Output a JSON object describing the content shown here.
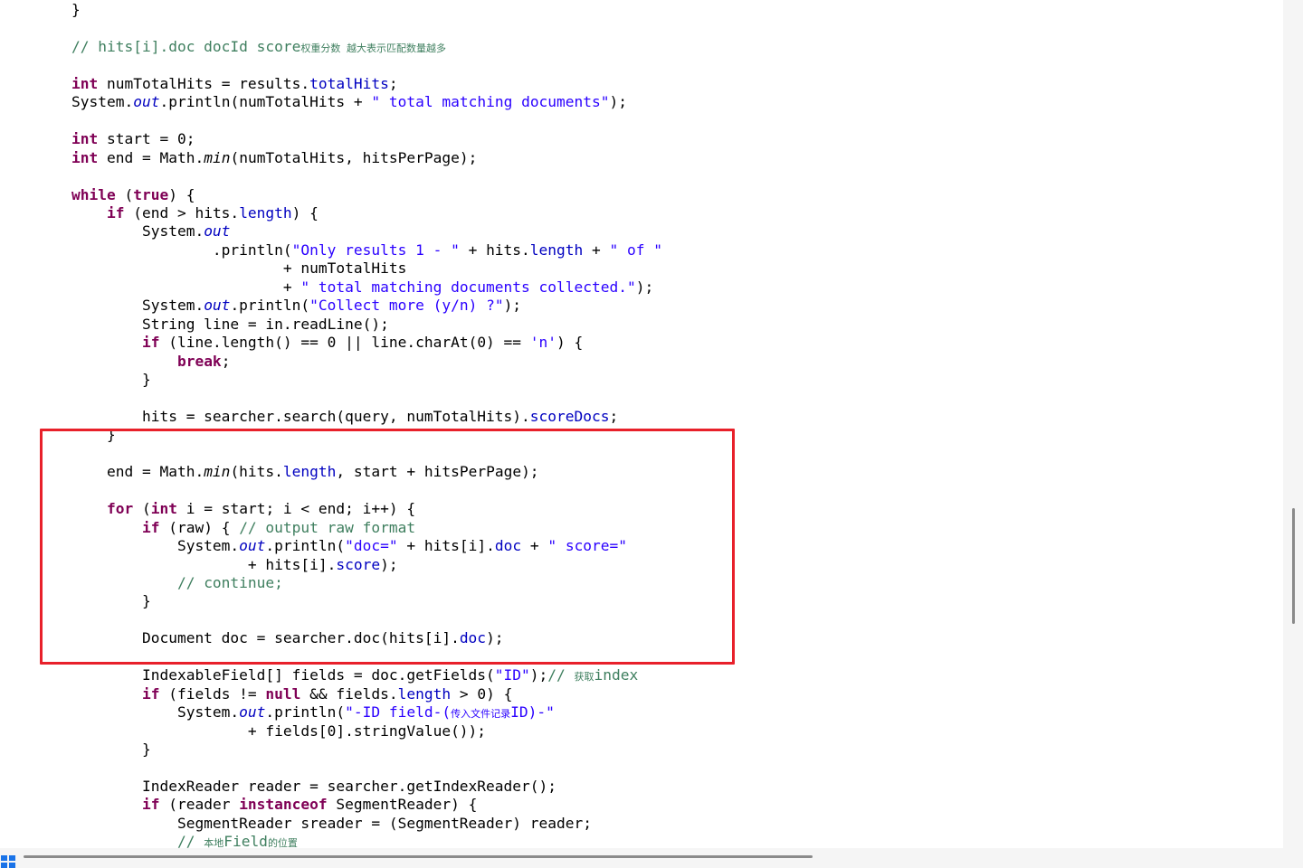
{
  "colors": {
    "keyword": "#7f0055",
    "string": "#2a00ff",
    "field": "#0000c0",
    "comment": "#3f7f5f",
    "highlight_border": "#e8202a"
  },
  "code_lines": [
    [
      {
        "t": "}"
      }
    ],
    [],
    [
      {
        "t": "// hits[i].doc docId score",
        "c": "cm"
      },
      {
        "t": "权重分数 越大表示匹配数量越多",
        "c": "cm cm-cn"
      }
    ],
    [],
    [
      {
        "t": "int",
        "c": "kw"
      },
      {
        "t": " numTotalHits = results."
      },
      {
        "t": "totalHits",
        "c": "fld"
      },
      {
        "t": ";"
      }
    ],
    [
      {
        "t": "System."
      },
      {
        "t": "out",
        "c": "sfld"
      },
      {
        "t": ".println(numTotalHits + "
      },
      {
        "t": "\" total matching documents\"",
        "c": "str"
      },
      {
        "t": ");"
      }
    ],
    [],
    [
      {
        "t": "int",
        "c": "kw"
      },
      {
        "t": " start = 0;"
      }
    ],
    [
      {
        "t": "int",
        "c": "kw"
      },
      {
        "t": " end = Math."
      },
      {
        "t": "min",
        "c": "sm"
      },
      {
        "t": "(numTotalHits, hitsPerPage);"
      }
    ],
    [],
    [
      {
        "t": "while",
        "c": "kw"
      },
      {
        "t": " ("
      },
      {
        "t": "true",
        "c": "kw"
      },
      {
        "t": ") {"
      }
    ],
    [
      {
        "t": "    "
      },
      {
        "t": "if",
        "c": "kw"
      },
      {
        "t": " (end > hits."
      },
      {
        "t": "length",
        "c": "fld"
      },
      {
        "t": ") {"
      }
    ],
    [
      {
        "t": "        System."
      },
      {
        "t": "out",
        "c": "sfld"
      }
    ],
    [
      {
        "t": "                .println("
      },
      {
        "t": "\"Only results 1 - \"",
        "c": "str"
      },
      {
        "t": " + hits."
      },
      {
        "t": "length",
        "c": "fld"
      },
      {
        "t": " + "
      },
      {
        "t": "\" of \"",
        "c": "str"
      }
    ],
    [
      {
        "t": "                        + numTotalHits"
      }
    ],
    [
      {
        "t": "                        + "
      },
      {
        "t": "\" total matching documents collected.\"",
        "c": "str"
      },
      {
        "t": ");"
      }
    ],
    [
      {
        "t": "        System."
      },
      {
        "t": "out",
        "c": "sfld"
      },
      {
        "t": ".println("
      },
      {
        "t": "\"Collect more (y/n) ?\"",
        "c": "str"
      },
      {
        "t": ");"
      }
    ],
    [
      {
        "t": "        String line = in.readLine();"
      }
    ],
    [
      {
        "t": "        "
      },
      {
        "t": "if",
        "c": "kw"
      },
      {
        "t": " (line.length() == 0 || line.charAt(0) == "
      },
      {
        "t": "'n'",
        "c": "str"
      },
      {
        "t": ") {"
      }
    ],
    [
      {
        "t": "            "
      },
      {
        "t": "break",
        "c": "kw"
      },
      {
        "t": ";"
      }
    ],
    [
      {
        "t": "        }"
      }
    ],
    [],
    [
      {
        "t": "        hits = searcher.search(query, numTotalHits)."
      },
      {
        "t": "scoreDocs",
        "c": "fld"
      },
      {
        "t": ";"
      }
    ],
    [
      {
        "t": "    }"
      }
    ],
    [],
    [
      {
        "t": "    end = Math."
      },
      {
        "t": "min",
        "c": "sm"
      },
      {
        "t": "(hits."
      },
      {
        "t": "length",
        "c": "fld"
      },
      {
        "t": ", start + hitsPerPage);"
      }
    ],
    [],
    [
      {
        "t": "    "
      },
      {
        "t": "for",
        "c": "kw"
      },
      {
        "t": " ("
      },
      {
        "t": "int",
        "c": "kw"
      },
      {
        "t": " i = start; i < end; i++) {"
      }
    ],
    [
      {
        "t": "        "
      },
      {
        "t": "if",
        "c": "kw"
      },
      {
        "t": " (raw) { "
      },
      {
        "t": "// output raw format",
        "c": "cm"
      }
    ],
    [
      {
        "t": "            System."
      },
      {
        "t": "out",
        "c": "sfld"
      },
      {
        "t": ".println("
      },
      {
        "t": "\"doc=\"",
        "c": "str"
      },
      {
        "t": " + hits[i]."
      },
      {
        "t": "doc",
        "c": "fld"
      },
      {
        "t": " + "
      },
      {
        "t": "\" score=\"",
        "c": "str"
      }
    ],
    [
      {
        "t": "                    + hits[i]."
      },
      {
        "t": "score",
        "c": "fld"
      },
      {
        "t": ");"
      }
    ],
    [
      {
        "t": "            "
      },
      {
        "t": "// continue;",
        "c": "cm"
      }
    ],
    [
      {
        "t": "        }"
      }
    ],
    [],
    [
      {
        "t": "        Document doc = searcher.doc(hits[i]."
      },
      {
        "t": "doc",
        "c": "fld"
      },
      {
        "t": ");"
      }
    ],
    [],
    [
      {
        "t": "        IndexableField[] fields = doc.getFields("
      },
      {
        "t": "\"ID\"",
        "c": "str"
      },
      {
        "t": ");"
      },
      {
        "t": "// ",
        "c": "cm"
      },
      {
        "t": "获取",
        "c": "cm cm-cn"
      },
      {
        "t": "index",
        "c": "cm"
      }
    ],
    [
      {
        "t": "        "
      },
      {
        "t": "if",
        "c": "kw"
      },
      {
        "t": " (fields != "
      },
      {
        "t": "null",
        "c": "kw"
      },
      {
        "t": " && fields."
      },
      {
        "t": "length",
        "c": "fld"
      },
      {
        "t": " > 0) {"
      }
    ],
    [
      {
        "t": "            System."
      },
      {
        "t": "out",
        "c": "sfld"
      },
      {
        "t": ".println("
      },
      {
        "t": "\"-ID field-(",
        "c": "str"
      },
      {
        "t": "传入文件记录",
        "c": "str cm-cn"
      },
      {
        "t": "ID)-\"",
        "c": "str"
      }
    ],
    [
      {
        "t": "                    + fields[0].stringValue());"
      }
    ],
    [
      {
        "t": "        }"
      }
    ],
    [],
    [
      {
        "t": "        IndexReader reader = searcher.getIndexReader();"
      }
    ],
    [
      {
        "t": "        "
      },
      {
        "t": "if",
        "c": "kw"
      },
      {
        "t": " (reader "
      },
      {
        "t": "instanceof",
        "c": "kw"
      },
      {
        "t": " SegmentReader) {"
      }
    ],
    [
      {
        "t": "            SegmentReader sreader = (SegmentReader) reader;"
      }
    ],
    [
      {
        "t": "            "
      },
      {
        "t": "// ",
        "c": "cm"
      },
      {
        "t": "本地",
        "c": "cm cm-cn"
      },
      {
        "t": "Field",
        "c": "cm"
      },
      {
        "t": "的位置",
        "c": "cm cm-cn"
      }
    ]
  ]
}
